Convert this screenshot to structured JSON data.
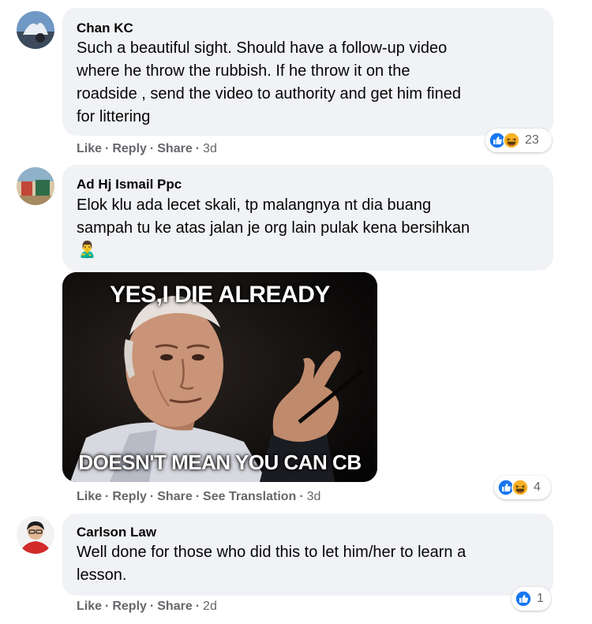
{
  "comments": [
    {
      "author": "Chan KC",
      "text": "Such a beautiful sight. Should have a follow-up video\nwhere he throw the rubbish. If he throw it on the\nroadside , send the video to authority and get him fined\nfor littering",
      "actions": {
        "like": "Like",
        "reply": "Reply",
        "share": "Share",
        "time": "3d"
      },
      "reactions": {
        "icons": [
          "like-icon",
          "haha-icon"
        ],
        "count": "23"
      }
    },
    {
      "author": "Ad Hj Ismail Ppc",
      "text": "Elok klu ada lecet skali, tp malangnya nt dia buang\nsampah tu ke atas jalan je org lain pulak kena bersihkan",
      "emoji": "🙎‍♂️",
      "meme": {
        "top": "YES,I DIE ALREADY",
        "bottom": "DOESN'T MEAN YOU CAN CB"
      },
      "actions": {
        "like": "Like",
        "reply": "Reply",
        "share": "Share",
        "translate": "See Translation",
        "time": "3d"
      },
      "reactions": {
        "icons": [
          "like-icon",
          "haha-icon"
        ],
        "count": "4"
      }
    },
    {
      "author": "Carlson Law",
      "text": "Well done for those who did this to let him/her to learn a\nlesson.",
      "actions": {
        "like": "Like",
        "reply": "Reply",
        "share": "Share",
        "time": "2d"
      },
      "reactions": {
        "icons": [
          "like-icon"
        ],
        "count": "1"
      }
    }
  ],
  "colors": {
    "bubble": "#f0f2f5",
    "meta": "#65676b",
    "like": "#1877f2",
    "haha": "#f7b125"
  }
}
